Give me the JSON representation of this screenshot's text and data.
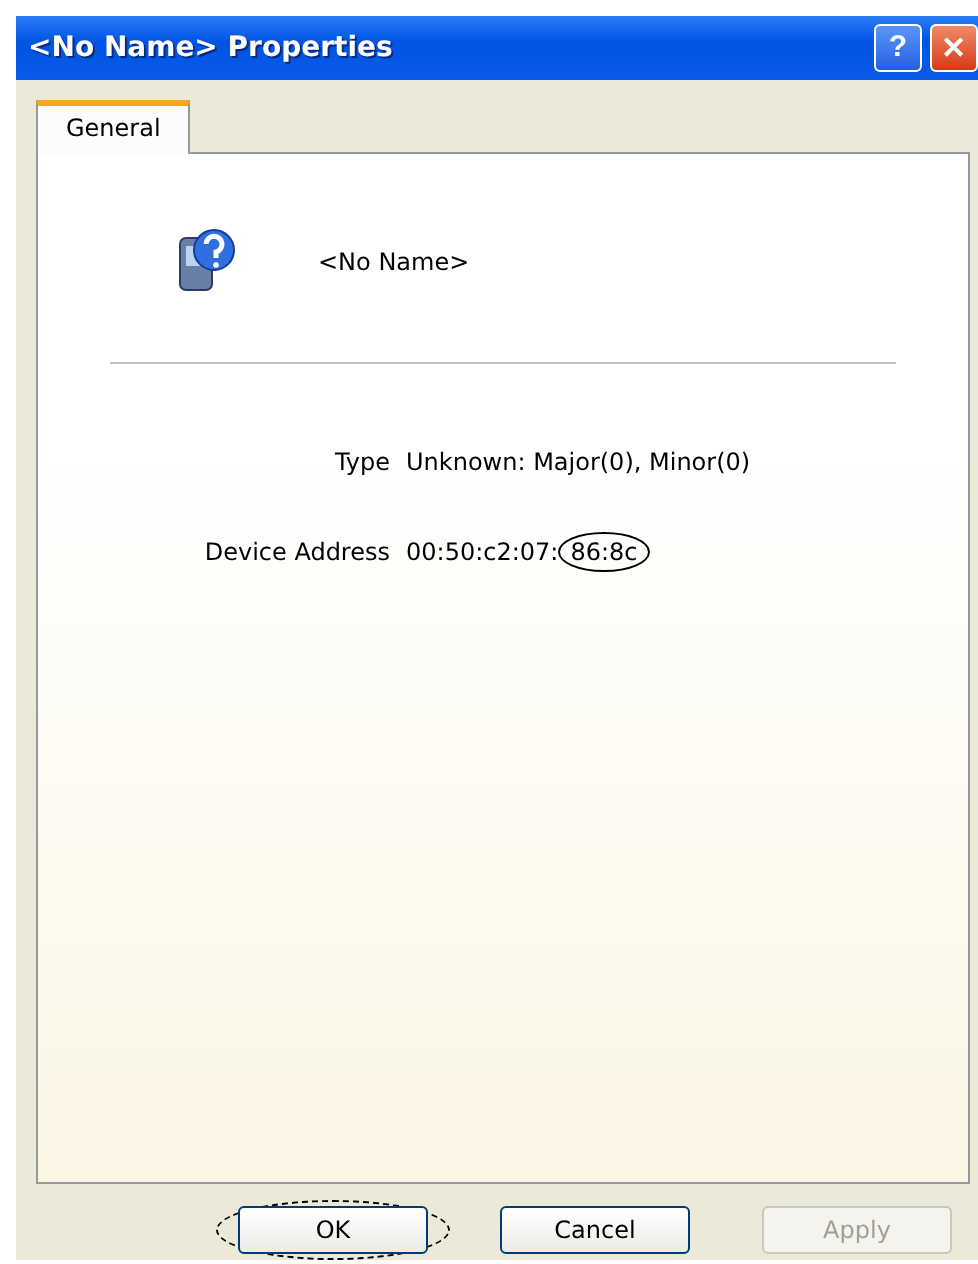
{
  "window": {
    "title": "<No Name> Properties",
    "controls": [
      {
        "kind": "help",
        "label": "?"
      },
      {
        "kind": "close",
        "label": "✕"
      }
    ]
  },
  "tabs": [
    {
      "label": "General",
      "selected": true
    }
  ],
  "device": {
    "name": "<No Name>"
  },
  "properties": [
    {
      "label": "Type",
      "value": "Unknown: Major(0), Minor(0)"
    },
    {
      "label": "Device Address",
      "value": "00:50:c2:07:",
      "circled_value": "86:8c"
    }
  ],
  "buttons": [
    {
      "label": "OK",
      "disabled": false,
      "circled": true
    },
    {
      "label": "Cancel",
      "disabled": false,
      "circled": false
    },
    {
      "label": "Apply",
      "disabled": true,
      "circled": false
    }
  ]
}
